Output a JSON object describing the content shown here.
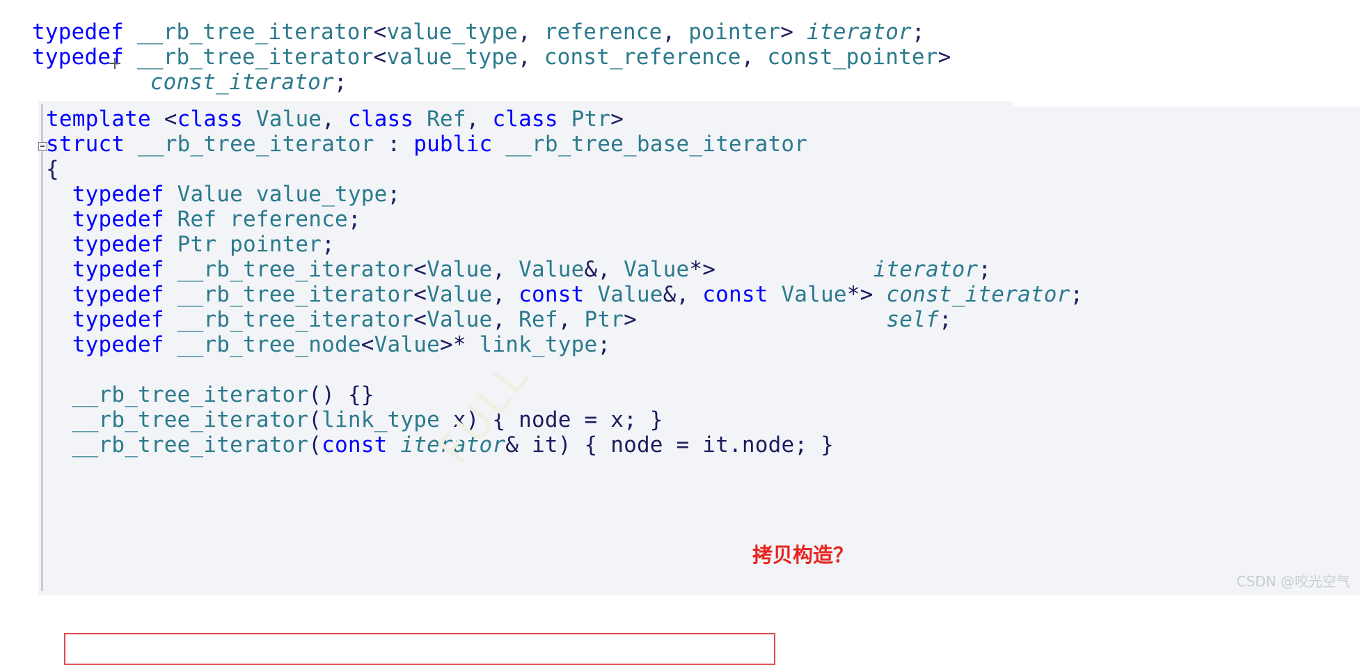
{
  "top_code": {
    "lines": [
      [
        {
          "t": "typedef",
          "c": "kw"
        },
        {
          "t": " __rb_tree_iterator",
          "c": "ty"
        },
        {
          "t": "<",
          "c": "pn"
        },
        {
          "t": "value_type",
          "c": "ty"
        },
        {
          "t": ", ",
          "c": "pn"
        },
        {
          "t": "reference",
          "c": "ty"
        },
        {
          "t": ", ",
          "c": "pn"
        },
        {
          "t": "pointer",
          "c": "ty"
        },
        {
          "t": "> ",
          "c": "pn"
        },
        {
          "t": "iterator",
          "c": "it"
        },
        {
          "t": ";",
          "c": "pn"
        }
      ],
      [
        {
          "t": "typedef",
          "c": "kw"
        },
        {
          "t": " __rb_tree_iterator",
          "c": "ty"
        },
        {
          "t": "<",
          "c": "pn"
        },
        {
          "t": "value_type",
          "c": "ty"
        },
        {
          "t": ", ",
          "c": "pn"
        },
        {
          "t": "const_reference",
          "c": "ty"
        },
        {
          "t": ", ",
          "c": "pn"
        },
        {
          "t": "const_pointer",
          "c": "ty"
        },
        {
          "t": ">",
          "c": "pn"
        }
      ],
      [
        {
          "t": "         ",
          "c": "pn"
        },
        {
          "t": "const_iterator",
          "c": "it"
        },
        {
          "t": ";",
          "c": "pn"
        }
      ]
    ]
  },
  "editor": {
    "lines": [
      [
        {
          "t": "template ",
          "c": "kw"
        },
        {
          "t": "<",
          "c": "pn"
        },
        {
          "t": "class",
          "c": "kw"
        },
        {
          "t": " Value",
          "c": "ty"
        },
        {
          "t": ", ",
          "c": "pn"
        },
        {
          "t": "class",
          "c": "kw"
        },
        {
          "t": " Ref",
          "c": "ty"
        },
        {
          "t": ", ",
          "c": "pn"
        },
        {
          "t": "class",
          "c": "kw"
        },
        {
          "t": " Ptr",
          "c": "ty"
        },
        {
          "t": ">",
          "c": "pn"
        }
      ],
      [
        {
          "t": "struct",
          "c": "kw"
        },
        {
          "t": " __rb_tree_iterator",
          "c": "ty"
        },
        {
          "t": " : ",
          "c": "pn"
        },
        {
          "t": "public",
          "c": "kw"
        },
        {
          "t": " __rb_tree_base_iterator",
          "c": "ty"
        }
      ],
      [
        {
          "t": "{",
          "c": "pn"
        }
      ],
      [
        {
          "t": "  ",
          "c": "pn"
        },
        {
          "t": "typedef",
          "c": "kw"
        },
        {
          "t": " Value value_type",
          "c": "ty"
        },
        {
          "t": ";",
          "c": "pn"
        }
      ],
      [
        {
          "t": "  ",
          "c": "pn"
        },
        {
          "t": "typedef",
          "c": "kw"
        },
        {
          "t": " Ref reference",
          "c": "ty"
        },
        {
          "t": ";",
          "c": "pn"
        }
      ],
      [
        {
          "t": "  ",
          "c": "pn"
        },
        {
          "t": "typedef",
          "c": "kw"
        },
        {
          "t": " Ptr pointer",
          "c": "ty"
        },
        {
          "t": ";",
          "c": "pn"
        }
      ],
      [
        {
          "t": "  ",
          "c": "pn"
        },
        {
          "t": "typedef",
          "c": "kw"
        },
        {
          "t": " __rb_tree_iterator",
          "c": "ty"
        },
        {
          "t": "<",
          "c": "pn"
        },
        {
          "t": "Value",
          "c": "ty"
        },
        {
          "t": ", ",
          "c": "pn"
        },
        {
          "t": "Value",
          "c": "ty"
        },
        {
          "t": "&, ",
          "c": "pn"
        },
        {
          "t": "Value",
          "c": "ty"
        },
        {
          "t": "*>",
          "c": "pn"
        },
        {
          "t": "            ",
          "c": "pn"
        },
        {
          "t": "iterator",
          "c": "it"
        },
        {
          "t": ";",
          "c": "pn"
        }
      ],
      [
        {
          "t": "  ",
          "c": "pn"
        },
        {
          "t": "typedef",
          "c": "kw"
        },
        {
          "t": " __rb_tree_iterator",
          "c": "ty"
        },
        {
          "t": "<",
          "c": "pn"
        },
        {
          "t": "Value",
          "c": "ty"
        },
        {
          "t": ", ",
          "c": "pn"
        },
        {
          "t": "const",
          "c": "kw"
        },
        {
          "t": " Value",
          "c": "ty"
        },
        {
          "t": "&, ",
          "c": "pn"
        },
        {
          "t": "const",
          "c": "kw"
        },
        {
          "t": " Value",
          "c": "ty"
        },
        {
          "t": "*> ",
          "c": "pn"
        },
        {
          "t": "const_iterator",
          "c": "it"
        },
        {
          "t": ";",
          "c": "pn"
        }
      ],
      [
        {
          "t": "  ",
          "c": "pn"
        },
        {
          "t": "typedef",
          "c": "kw"
        },
        {
          "t": " __rb_tree_iterator",
          "c": "ty"
        },
        {
          "t": "<",
          "c": "pn"
        },
        {
          "t": "Value",
          "c": "ty"
        },
        {
          "t": ", ",
          "c": "pn"
        },
        {
          "t": "Ref",
          "c": "ty"
        },
        {
          "t": ", ",
          "c": "pn"
        },
        {
          "t": "Ptr",
          "c": "ty"
        },
        {
          "t": ">",
          "c": "pn"
        },
        {
          "t": "                   ",
          "c": "pn"
        },
        {
          "t": "self",
          "c": "it"
        },
        {
          "t": ";",
          "c": "pn"
        }
      ],
      [
        {
          "t": "  ",
          "c": "pn"
        },
        {
          "t": "typedef",
          "c": "kw"
        },
        {
          "t": " __rb_tree_node",
          "c": "ty"
        },
        {
          "t": "<",
          "c": "pn"
        },
        {
          "t": "Value",
          "c": "ty"
        },
        {
          "t": ">* ",
          "c": "pn"
        },
        {
          "t": "link_type",
          "c": "ty"
        },
        {
          "t": ";",
          "c": "pn"
        }
      ],
      [
        {
          "t": "",
          "c": "pn"
        }
      ],
      [
        {
          "t": "  ",
          "c": "pn"
        },
        {
          "t": "__rb_tree_iterator",
          "c": "ty"
        },
        {
          "t": "() {}",
          "c": "pn"
        }
      ],
      [
        {
          "t": "  ",
          "c": "pn"
        },
        {
          "t": "__rb_tree_iterator",
          "c": "ty"
        },
        {
          "t": "(",
          "c": "pn"
        },
        {
          "t": "link_type",
          "c": "ty"
        },
        {
          "t": " x",
          "c": "id"
        },
        {
          "t": ") { ",
          "c": "pn"
        },
        {
          "t": "node",
          "c": "id"
        },
        {
          "t": " = ",
          "c": "pn"
        },
        {
          "t": "x",
          "c": "id"
        },
        {
          "t": "; }",
          "c": "pn"
        }
      ],
      [
        {
          "t": "  ",
          "c": "pn"
        },
        {
          "t": "__rb_tree_iterator",
          "c": "ty"
        },
        {
          "t": "(",
          "c": "pn"
        },
        {
          "t": "const",
          "c": "kw"
        },
        {
          "t": " ",
          "c": "pn"
        },
        {
          "t": "iterator",
          "c": "it"
        },
        {
          "t": "& it",
          "c": "pn"
        },
        {
          "t": ") { ",
          "c": "pn"
        },
        {
          "t": "node",
          "c": "id"
        },
        {
          "t": " = ",
          "c": "pn"
        },
        {
          "t": "it",
          "c": "id"
        },
        {
          "t": ".",
          "c": "pn"
        },
        {
          "t": "node",
          "c": "id"
        },
        {
          "t": "; }",
          "c": "pn"
        }
      ]
    ]
  },
  "annotation": {
    "text": "拷贝构造？",
    "color": "#e8241f"
  },
  "highlight": {
    "border_color": "#d94c4c"
  },
  "watermarks": {
    "diagonal": "FULL",
    "csdn": "CSDN @咬光空气"
  },
  "theme": {
    "page_background": "#ffffff",
    "editor_background": "#f2f4f8",
    "keyword_color": "#0000ff",
    "type_color": "#2b7a8c",
    "punctuation_color": "#1c1c5e"
  }
}
